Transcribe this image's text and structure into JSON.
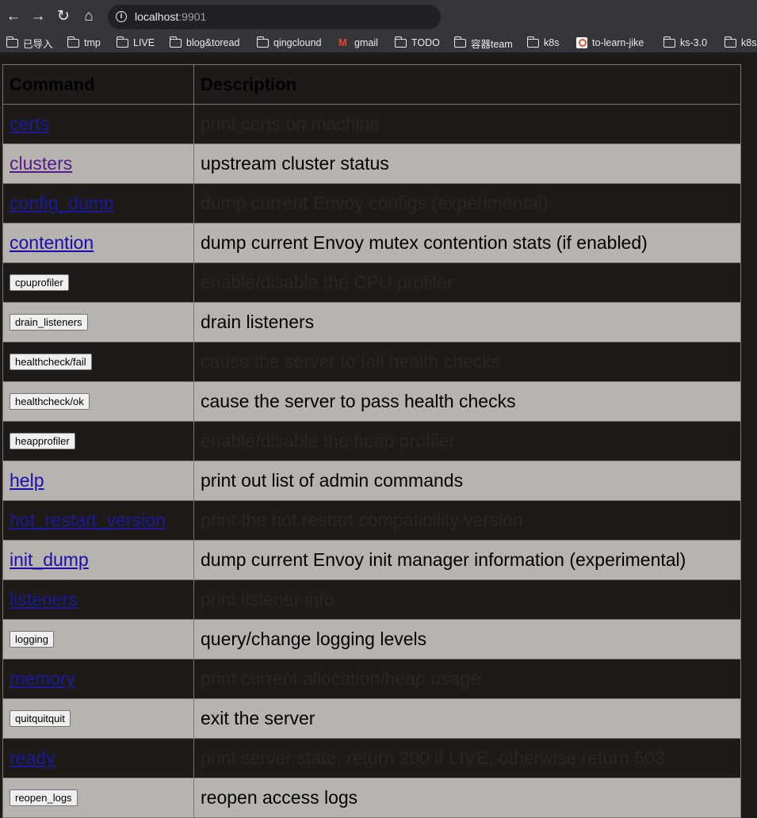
{
  "browser": {
    "url_host": "localhost",
    "url_port": ":9901",
    "bookmarks": [
      {
        "label": "已导入",
        "icon": "folder-icon"
      },
      {
        "label": "tmp",
        "icon": "folder-icon"
      },
      {
        "label": "LIVE",
        "icon": "folder-icon"
      },
      {
        "label": "blog&toread",
        "icon": "folder-icon"
      },
      {
        "label": "qingclound",
        "icon": "folder-icon"
      },
      {
        "label": "gmail",
        "icon": "gmail-icon"
      },
      {
        "label": "TODO",
        "icon": "folder-icon"
      },
      {
        "label": "容器team",
        "icon": "folder-icon"
      },
      {
        "label": "k8s",
        "icon": "folder-icon"
      },
      {
        "label": "to-learn-jike",
        "icon": "jike-icon"
      },
      {
        "label": "ks-3.0",
        "icon": "folder-icon"
      },
      {
        "label": "k8s",
        "icon": "folder-icon"
      }
    ]
  },
  "table": {
    "header_command": "Command",
    "header_description": "Description",
    "rows": [
      {
        "cmd": "certs",
        "kind": "link",
        "desc": "print certs on machine"
      },
      {
        "cmd": "clusters",
        "kind": "link",
        "visited": true,
        "desc": "upstream cluster status"
      },
      {
        "cmd": "config_dump",
        "kind": "link",
        "desc": "dump current Envoy configs (experimental)"
      },
      {
        "cmd": "contention",
        "kind": "link",
        "desc": "dump current Envoy mutex contention stats (if enabled)"
      },
      {
        "cmd": "cpuprofiler",
        "kind": "button",
        "desc": "enable/disable the CPU profiler"
      },
      {
        "cmd": "drain_listeners",
        "kind": "button",
        "desc": "drain listeners"
      },
      {
        "cmd": "healthcheck/fail",
        "kind": "button",
        "desc": "cause the server to fail health checks"
      },
      {
        "cmd": "healthcheck/ok",
        "kind": "button",
        "desc": "cause the server to pass health checks"
      },
      {
        "cmd": "heapprofiler",
        "kind": "button",
        "desc": "enable/disable the heap profiler"
      },
      {
        "cmd": "help",
        "kind": "link",
        "desc": "print out list of admin commands"
      },
      {
        "cmd": "hot_restart_version",
        "kind": "link",
        "desc": "print the hot restart compatibility version"
      },
      {
        "cmd": "init_dump",
        "kind": "link",
        "desc": "dump current Envoy init manager information (experimental)"
      },
      {
        "cmd": "listeners",
        "kind": "link",
        "desc": "print listener info"
      },
      {
        "cmd": "logging",
        "kind": "button",
        "desc": "query/change logging levels"
      },
      {
        "cmd": "memory",
        "kind": "link",
        "desc": "print current allocation/heap usage"
      },
      {
        "cmd": "quitquitquit",
        "kind": "button",
        "desc": "exit the server"
      },
      {
        "cmd": "ready",
        "kind": "link",
        "desc": "print server state, return 200 if LIVE, otherwise return 503"
      },
      {
        "cmd": "reopen_logs",
        "kind": "button",
        "desc": "reopen access logs"
      }
    ]
  }
}
